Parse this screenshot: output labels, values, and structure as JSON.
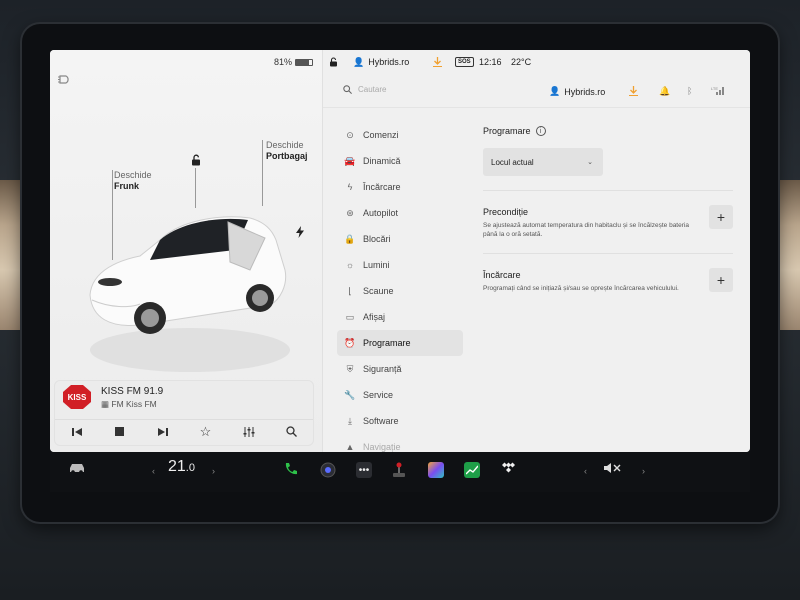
{
  "status": {
    "battery": "81%",
    "battery_level": 0.81,
    "profile": "Hybrids.ro",
    "sos": "SOS",
    "time": "12:16",
    "temperature": "22°C"
  },
  "topbar": {
    "search_placeholder": "Cautare",
    "user_name": "Hybrids.ro"
  },
  "car": {
    "frunk_open": "Deschide",
    "frunk_label": "Frunk",
    "trunk_open": "Deschide",
    "trunk_label": "Portbagaj"
  },
  "media": {
    "station": "KISS FM 91.9",
    "subtitle": "FM Kiss FM",
    "logo_text": "KISS"
  },
  "menu": {
    "items": [
      {
        "label": "Comenzi",
        "icon": "toggle-icon"
      },
      {
        "label": "Dinamică",
        "icon": "car-icon"
      },
      {
        "label": "Încărcare",
        "icon": "bolt-icon"
      },
      {
        "label": "Autopilot",
        "icon": "steering-wheel-icon"
      },
      {
        "label": "Blocări",
        "icon": "lock-icon"
      },
      {
        "label": "Lumini",
        "icon": "sun-icon"
      },
      {
        "label": "Scaune",
        "icon": "seat-icon"
      },
      {
        "label": "Afișaj",
        "icon": "display-icon"
      },
      {
        "label": "Programare",
        "icon": "alarm-clock-icon",
        "active": true
      },
      {
        "label": "Siguranță",
        "icon": "shield-icon"
      },
      {
        "label": "Service",
        "icon": "wrench-icon"
      },
      {
        "label": "Software",
        "icon": "download-icon"
      },
      {
        "label": "Navigație",
        "icon": "navigation-icon"
      }
    ]
  },
  "content": {
    "section_title": "Programare",
    "dropdown_value": "Locul actual",
    "preconditioning": {
      "title": "Precondiție",
      "desc": "Se ajustează automat temperatura din habitaclu și se încălzește bateria până la o oră setată."
    },
    "charging": {
      "title": "Încărcare",
      "desc": "Programați când se inițiază și/sau se oprește încărcarea vehiculului."
    }
  },
  "dock": {
    "temperature_main": "21",
    "temperature_decimal": ".0"
  },
  "colors": {
    "accent_download": "#f0a030",
    "phone_green": "#2ec24a",
    "kiss_red": "#d11f26"
  }
}
